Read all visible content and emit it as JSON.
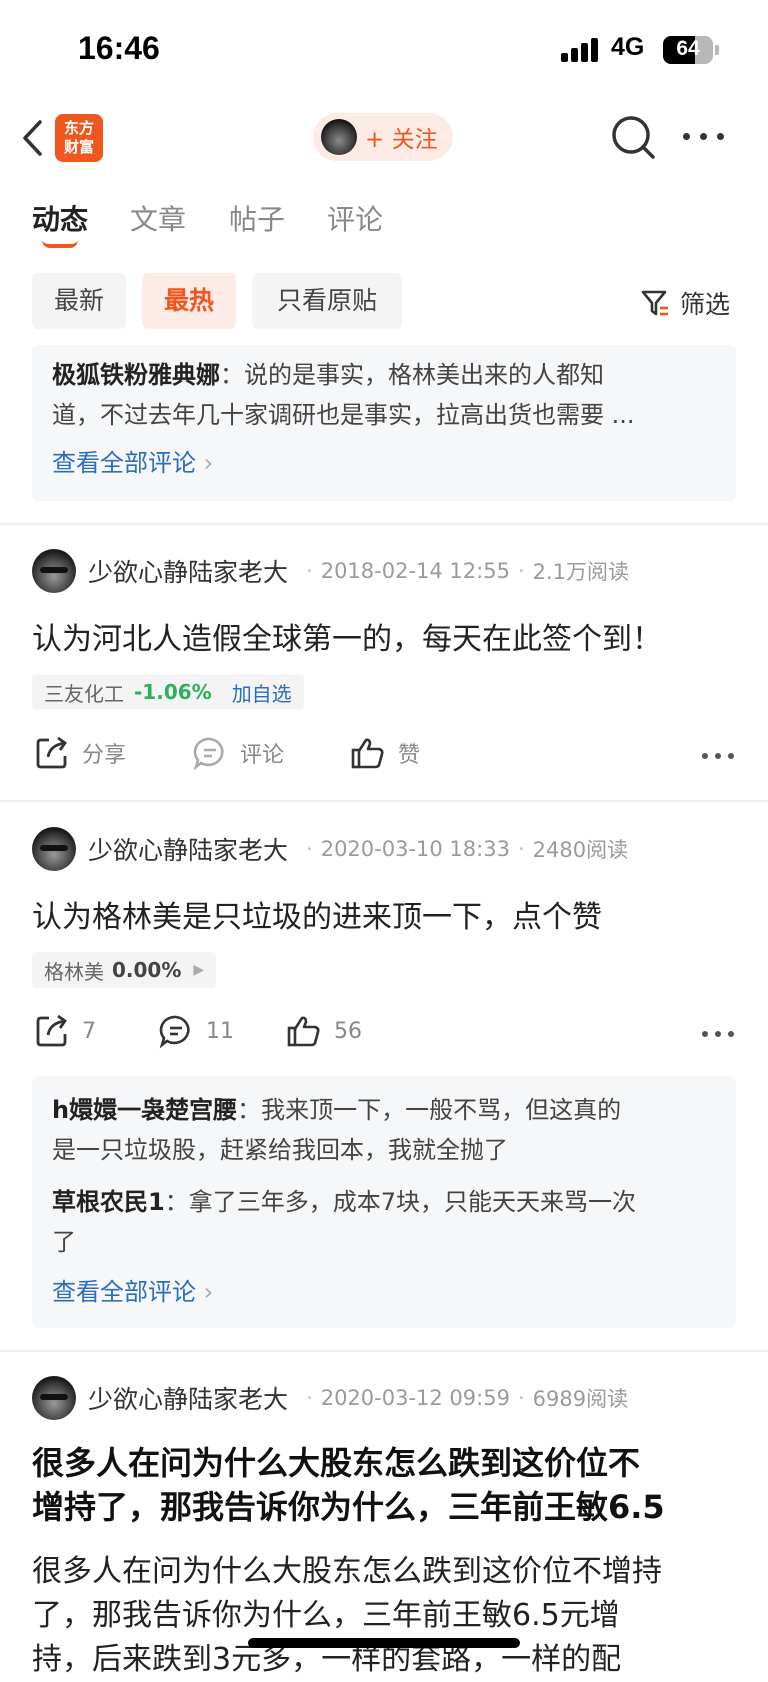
{
  "status_bar": {
    "time": "16:46",
    "network": "4G",
    "battery": "64"
  },
  "nav": {
    "logo_line1": "东方",
    "logo_line2": "财富",
    "follow_label": "+ 关注"
  },
  "tabs": [
    {
      "label": "动态",
      "active": true
    },
    {
      "label": "文章",
      "active": false
    },
    {
      "label": "帖子",
      "active": false
    },
    {
      "label": "评论",
      "active": false
    }
  ],
  "filters": {
    "newest": "最新",
    "hottest": "最热",
    "original_only": "只看原贴",
    "filter": "筛选"
  },
  "top_comments": {
    "comment": {
      "user": "极狐铁粉雅典娜",
      "line1": "说的是事实，格林美出来的人都知",
      "line2": "道，不过去年几十家调研也是事实，拉高出货也需要 ..."
    },
    "view_all": "查看全部评论"
  },
  "posts": [
    {
      "user": "少欲心静陆家老大",
      "date": "2018-02-14 12:55",
      "reads": "2.1万阅读",
      "title": "认为河北人造假全球第一的，每天在此签个到！",
      "stock": {
        "name": "三友化工",
        "change": "-1.06%",
        "add": "加自选"
      },
      "share": "分享",
      "comment": "评论",
      "like": "赞"
    },
    {
      "user": "少欲心静陆家老大",
      "date": "2020-03-10 18:33",
      "reads": "2480阅读",
      "title": "认为格林美是只垃圾的进来顶一下，点个赞",
      "stock": {
        "name": "格林美",
        "change": "0.00%"
      },
      "share": "7",
      "comment": "11",
      "like": "56",
      "comments": [
        {
          "user": "h嬛嬛一袅楚宫腰",
          "line1": "我来顶一下，一般不骂，但这真的",
          "line2": "是一只垃圾股，赶紧给我回本，我就全抛了"
        },
        {
          "user": "草根农民1",
          "line1": "拿了三年多，成本7块，只能天天来骂一次",
          "line2": "了"
        }
      ],
      "view_all": "查看全部评论"
    },
    {
      "user": "少欲心静陆家老大",
      "date": "2020-03-12 09:59",
      "reads": "6989阅读",
      "title_line1": "很多人在问为什么大股东怎么跌到这价位不",
      "title_line2": "增持了，那我告诉你为什么，三年前王敏6.5",
      "body_line1": "很多人在问为什么大股东怎么跌到这价位不增持",
      "body_line2": "了，那我告诉你为什么，三年前王敏6.5元增",
      "body_line3": "持，后来跌到3元多，一样的套路，一样的配"
    }
  ]
}
